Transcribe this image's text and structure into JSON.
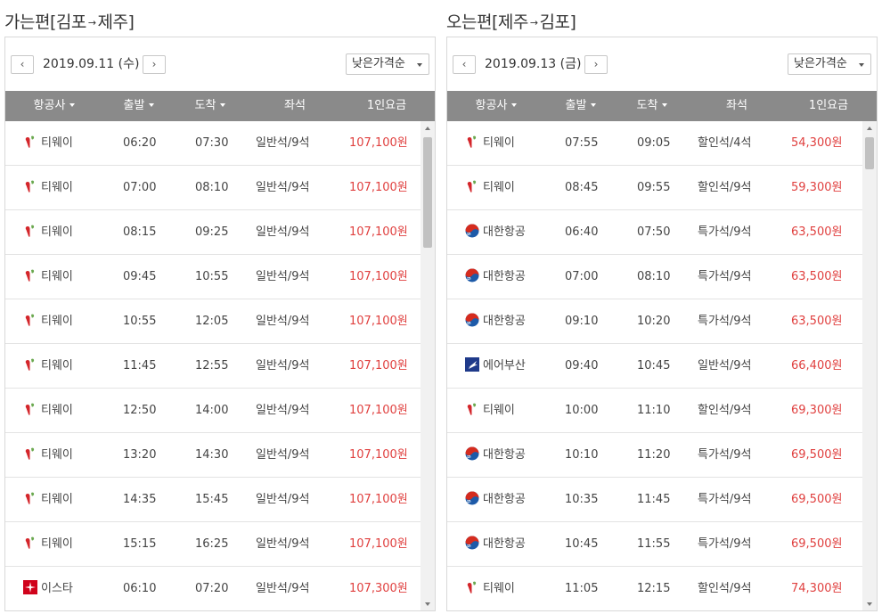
{
  "outbound": {
    "title_prefix": "가는편[",
    "title_from": "김포",
    "title_arrow": "→",
    "title_to": "제주",
    "title_suffix": "]",
    "prev_label": "‹",
    "next_label": "›",
    "date": "2019.09.11 (수)",
    "sort": "낮은가격순",
    "headers": {
      "airline": "항공사",
      "depart": "출발",
      "arrive": "도착",
      "seat": "좌석",
      "price": "1인요금"
    },
    "flights": [
      {
        "airline": "티웨이",
        "logo": "tway-icon",
        "depart": "06:20",
        "arrive": "07:30",
        "seat": "일반석/9석",
        "price": "107,100원"
      },
      {
        "airline": "티웨이",
        "logo": "tway-icon",
        "depart": "07:00",
        "arrive": "08:10",
        "seat": "일반석/9석",
        "price": "107,100원"
      },
      {
        "airline": "티웨이",
        "logo": "tway-icon",
        "depart": "08:15",
        "arrive": "09:25",
        "seat": "일반석/9석",
        "price": "107,100원"
      },
      {
        "airline": "티웨이",
        "logo": "tway-icon",
        "depart": "09:45",
        "arrive": "10:55",
        "seat": "일반석/9석",
        "price": "107,100원"
      },
      {
        "airline": "티웨이",
        "logo": "tway-icon",
        "depart": "10:55",
        "arrive": "12:05",
        "seat": "일반석/9석",
        "price": "107,100원"
      },
      {
        "airline": "티웨이",
        "logo": "tway-icon",
        "depart": "11:45",
        "arrive": "12:55",
        "seat": "일반석/9석",
        "price": "107,100원"
      },
      {
        "airline": "티웨이",
        "logo": "tway-icon",
        "depart": "12:50",
        "arrive": "14:00",
        "seat": "일반석/9석",
        "price": "107,100원"
      },
      {
        "airline": "티웨이",
        "logo": "tway-icon",
        "depart": "13:20",
        "arrive": "14:30",
        "seat": "일반석/9석",
        "price": "107,100원"
      },
      {
        "airline": "티웨이",
        "logo": "tway-icon",
        "depart": "14:35",
        "arrive": "15:45",
        "seat": "일반석/9석",
        "price": "107,100원"
      },
      {
        "airline": "티웨이",
        "logo": "tway-icon",
        "depart": "15:15",
        "arrive": "16:25",
        "seat": "일반석/9석",
        "price": "107,100원"
      },
      {
        "airline": "이스타",
        "logo": "eastar-icon",
        "depart": "06:10",
        "arrive": "07:20",
        "seat": "일반석/9석",
        "price": "107,300원"
      }
    ]
  },
  "inbound": {
    "title_prefix": "오는편[",
    "title_from": "제주",
    "title_arrow": "→",
    "title_to": "김포",
    "title_suffix": "]",
    "prev_label": "‹",
    "next_label": "›",
    "date": "2019.09.13 (금)",
    "sort": "낮은가격순",
    "headers": {
      "airline": "항공사",
      "depart": "출발",
      "arrive": "도착",
      "seat": "좌석",
      "price": "1인요금"
    },
    "flights": [
      {
        "airline": "티웨이",
        "logo": "tway-icon",
        "depart": "07:55",
        "arrive": "09:05",
        "seat": "할인석/4석",
        "price": "54,300원"
      },
      {
        "airline": "티웨이",
        "logo": "tway-icon",
        "depart": "08:45",
        "arrive": "09:55",
        "seat": "할인석/9석",
        "price": "59,300원"
      },
      {
        "airline": "대한항공",
        "logo": "korean-air-icon",
        "depart": "06:40",
        "arrive": "07:50",
        "seat": "특가석/9석",
        "price": "63,500원"
      },
      {
        "airline": "대한항공",
        "logo": "korean-air-icon",
        "depart": "07:00",
        "arrive": "08:10",
        "seat": "특가석/9석",
        "price": "63,500원"
      },
      {
        "airline": "대한항공",
        "logo": "korean-air-icon",
        "depart": "09:10",
        "arrive": "10:20",
        "seat": "특가석/9석",
        "price": "63,500원"
      },
      {
        "airline": "에어부산",
        "logo": "air-busan-icon",
        "depart": "09:40",
        "arrive": "10:45",
        "seat": "일반석/9석",
        "price": "66,400원"
      },
      {
        "airline": "티웨이",
        "logo": "tway-icon",
        "depart": "10:00",
        "arrive": "11:10",
        "seat": "할인석/9석",
        "price": "69,300원"
      },
      {
        "airline": "대한항공",
        "logo": "korean-air-icon",
        "depart": "10:10",
        "arrive": "11:20",
        "seat": "특가석/9석",
        "price": "69,500원"
      },
      {
        "airline": "대한항공",
        "logo": "korean-air-icon",
        "depart": "10:35",
        "arrive": "11:45",
        "seat": "특가석/9석",
        "price": "69,500원"
      },
      {
        "airline": "대한항공",
        "logo": "korean-air-icon",
        "depart": "10:45",
        "arrive": "11:55",
        "seat": "특가석/9석",
        "price": "69,500원"
      },
      {
        "airline": "티웨이",
        "logo": "tway-icon",
        "depart": "11:05",
        "arrive": "12:15",
        "seat": "할인석/9석",
        "price": "74,300원"
      }
    ]
  },
  "colors": {
    "header_bg": "#8a8a8a",
    "price": "#e0403f",
    "tway": "#d4262b",
    "tway_leaf": "#6aa84f",
    "korean_red": "#d52b1e",
    "korean_blue": "#1d5aa8",
    "air_busan": "#1f3a8a",
    "eastar": "#d0021b"
  }
}
